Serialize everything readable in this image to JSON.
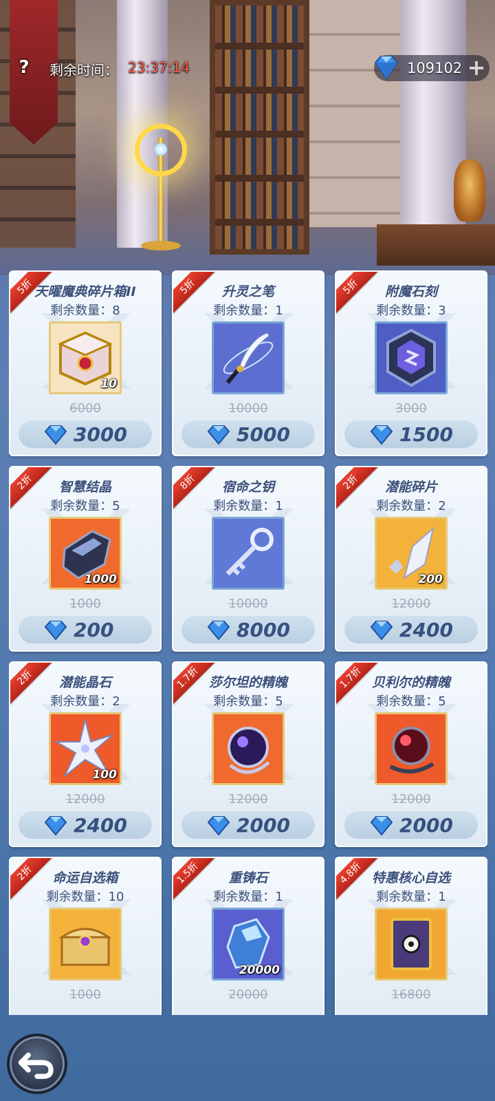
{
  "header": {
    "timer_label": "剩余时间：",
    "timer_value": "23:37:14",
    "currency_amount": "109102"
  },
  "colors": {
    "timer": "#ff5a4a",
    "discount_ribbon": "#d8331f",
    "price_text": "#36507f"
  },
  "items": [
    {
      "discount": "5折",
      "name": "天曜魔典碎片箱II",
      "remaining": "剩余数量：8",
      "qty": "10",
      "old_price": "6000",
      "price": "3000",
      "icon": "treasure-chest-icon"
    },
    {
      "discount": "5折",
      "name": "升灵之笔",
      "remaining": "剩余数量：1",
      "qty": "",
      "old_price": "10000",
      "price": "5000",
      "icon": "quill-icon"
    },
    {
      "discount": "5折",
      "name": "附魔石刻",
      "remaining": "剩余数量：3",
      "qty": "",
      "old_price": "3000",
      "price": "1500",
      "icon": "rune-stone-icon"
    },
    {
      "discount": "2折",
      "name": "智慧结晶",
      "remaining": "剩余数量：5",
      "qty": "1000",
      "old_price": "1000",
      "price": "200",
      "icon": "crystal-icon"
    },
    {
      "discount": "8折",
      "name": "宿命之钥",
      "remaining": "剩余数量：1",
      "qty": "",
      "old_price": "10000",
      "price": "8000",
      "icon": "key-icon"
    },
    {
      "discount": "2折",
      "name": "潜能碎片",
      "remaining": "剩余数量：2",
      "qty": "200",
      "old_price": "12000",
      "price": "2400",
      "icon": "shard-icon"
    },
    {
      "discount": "2折",
      "name": "潜能晶石",
      "remaining": "剩余数量：2",
      "qty": "100",
      "old_price": "12000",
      "price": "2400",
      "icon": "star-crystal-icon"
    },
    {
      "discount": "1.7折",
      "name": "莎尔坦的精魄",
      "remaining": "剩余数量：5",
      "qty": "",
      "old_price": "12000",
      "price": "2000",
      "icon": "purple-orb-icon"
    },
    {
      "discount": "1.7折",
      "name": "贝利尔的精魄",
      "remaining": "剩余数量：5",
      "qty": "",
      "old_price": "12000",
      "price": "2000",
      "icon": "red-orb-icon"
    },
    {
      "discount": "2折",
      "name": "命运自选箱",
      "remaining": "剩余数量：10",
      "qty": "",
      "old_price": "1000",
      "price": "",
      "icon": "golden-chest-icon"
    },
    {
      "discount": "1.5折",
      "name": "重铸石",
      "remaining": "剩余数量：1",
      "qty": "20000",
      "old_price": "20000",
      "price": "",
      "icon": "reforge-stone-icon"
    },
    {
      "discount": "4.8折",
      "name": "特惠核心自选",
      "remaining": "剩余数量：1",
      "qty": "",
      "old_price": "16800",
      "price": "",
      "icon": "core-card-icon"
    }
  ]
}
